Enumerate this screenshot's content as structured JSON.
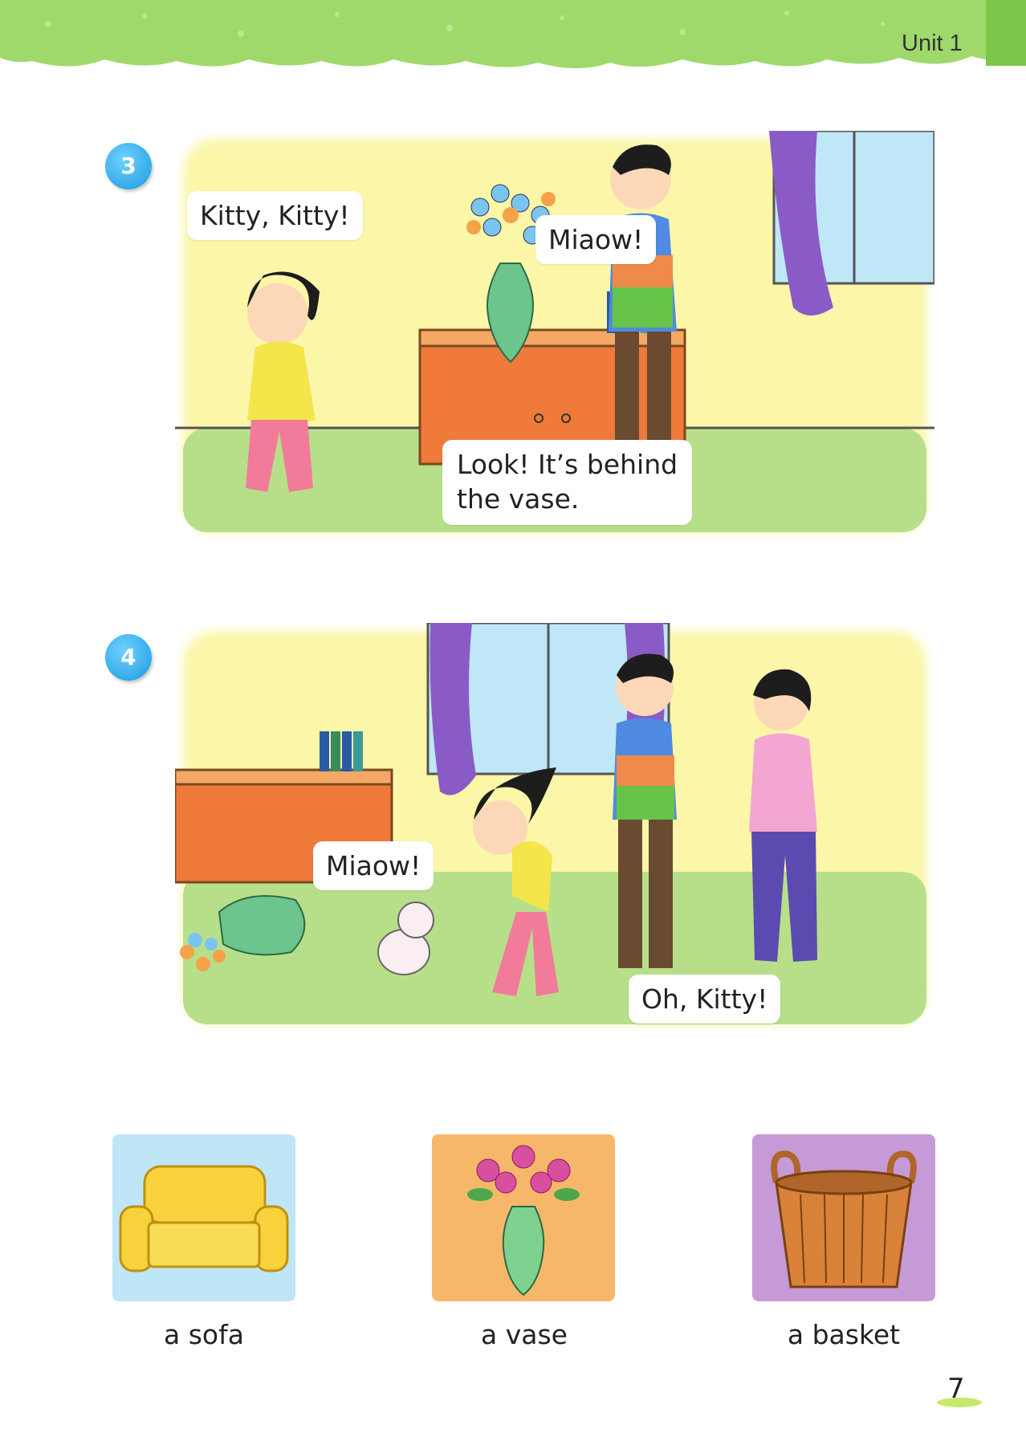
{
  "header": {
    "unit_label": "Unit 1"
  },
  "panels": [
    {
      "number": "3",
      "bubbles": [
        "Kitty, Kitty!",
        "Miaow!",
        "Look! It’s behind",
        "the vase."
      ]
    },
    {
      "number": "4",
      "bubbles": [
        "Miaow!",
        "Oh, Kitty!"
      ]
    }
  ],
  "vocabulary": [
    {
      "label": "a sofa",
      "icon": "sofa-icon",
      "color": "#bfe6f7"
    },
    {
      "label": "a vase",
      "icon": "vase-icon",
      "color": "#f7b76a"
    },
    {
      "label": "a basket",
      "icon": "basket-icon",
      "color": "#c69ad6"
    }
  ],
  "footer": {
    "page_number": "7"
  }
}
